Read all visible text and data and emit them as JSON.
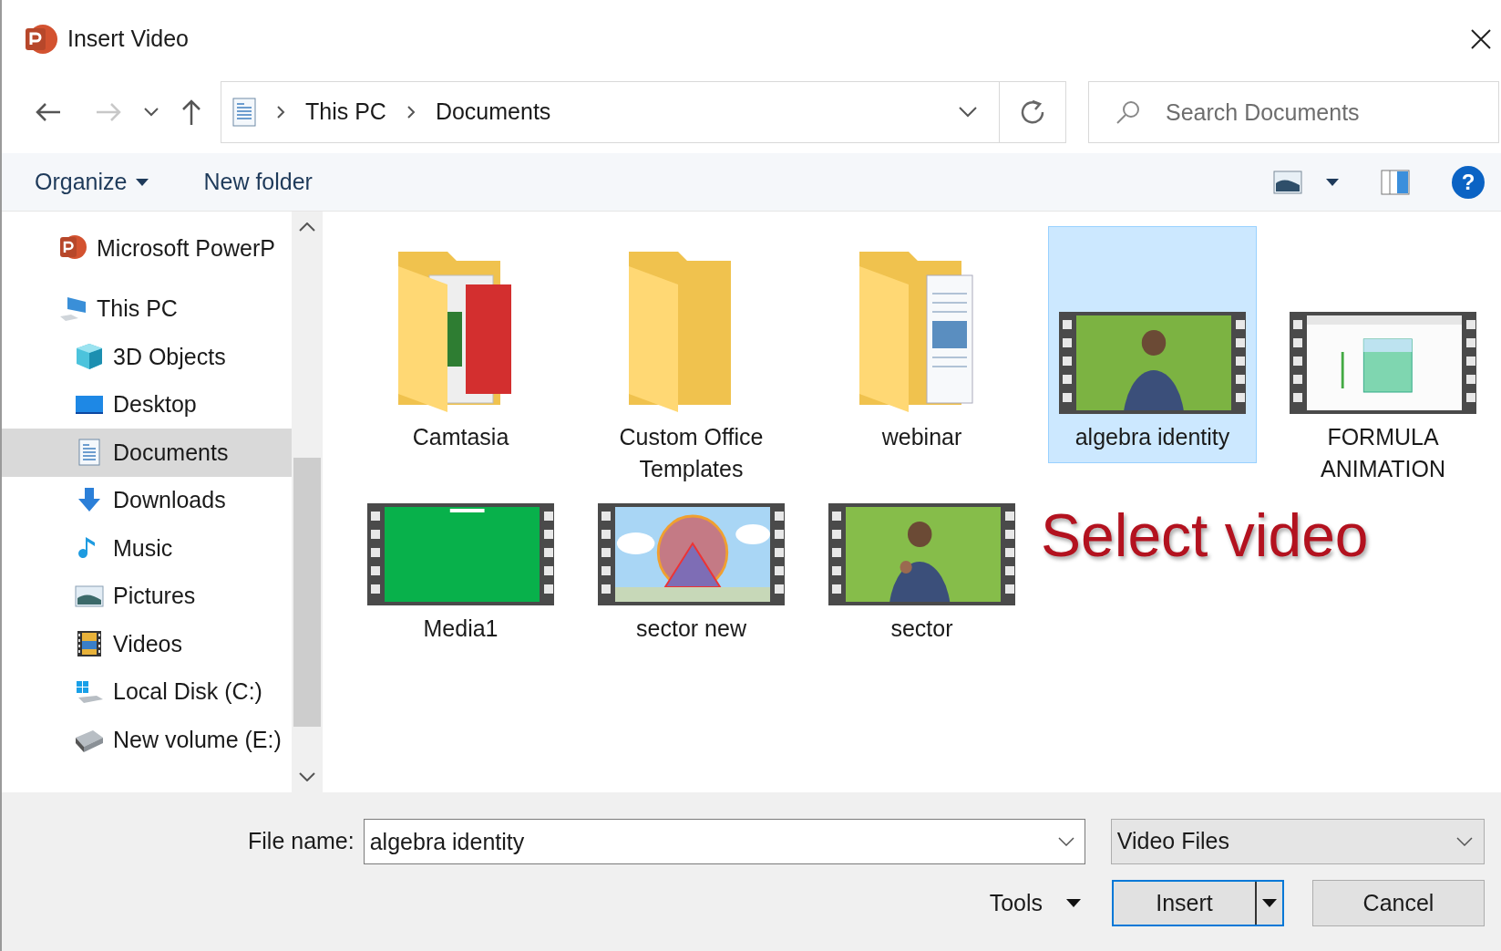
{
  "window": {
    "title": "Insert Video"
  },
  "address": {
    "path": [
      "This PC",
      "Documents"
    ]
  },
  "search": {
    "placeholder": "Search Documents"
  },
  "toolbar": {
    "organize": "Organize",
    "new_folder": "New folder",
    "help": "?"
  },
  "sidebar": {
    "items": [
      {
        "label": "Microsoft PowerP",
        "kind": "app",
        "selected": false
      },
      {
        "label": "This PC",
        "kind": "pc",
        "selected": false,
        "children": [
          {
            "label": "3D Objects",
            "kind": "cube",
            "selected": false
          },
          {
            "label": "Desktop",
            "kind": "desktop",
            "selected": false
          },
          {
            "label": "Documents",
            "kind": "documents",
            "selected": true
          },
          {
            "label": "Downloads",
            "kind": "downloads",
            "selected": false
          },
          {
            "label": "Music",
            "kind": "music",
            "selected": false
          },
          {
            "label": "Pictures",
            "kind": "pictures",
            "selected": false
          },
          {
            "label": "Videos",
            "kind": "videos",
            "selected": false
          },
          {
            "label": "Local Disk (C:)",
            "kind": "disk",
            "selected": false
          },
          {
            "label": "New volume (E:)",
            "kind": "drive",
            "selected": false
          }
        ]
      }
    ]
  },
  "files": [
    {
      "name": "Camtasia",
      "kind": "folder",
      "selected": false
    },
    {
      "name": "Custom Office Templates",
      "kind": "folder",
      "selected": false
    },
    {
      "name": "webinar",
      "kind": "folder",
      "selected": false
    },
    {
      "name": "algebra identity",
      "kind": "video",
      "selected": true
    },
    {
      "name": "FORMULA ANIMATION",
      "kind": "video",
      "selected": false
    },
    {
      "name": "Media1",
      "kind": "video",
      "selected": false
    },
    {
      "name": "sector new",
      "kind": "video",
      "selected": false
    },
    {
      "name": "sector",
      "kind": "video",
      "selected": false
    }
  ],
  "annotation": "Select video",
  "file_name": {
    "label": "File name:",
    "value": "algebra identity"
  },
  "file_type": {
    "value": "Video Files"
  },
  "buttons": {
    "tools": "Tools",
    "insert": "Insert",
    "cancel": "Cancel"
  }
}
